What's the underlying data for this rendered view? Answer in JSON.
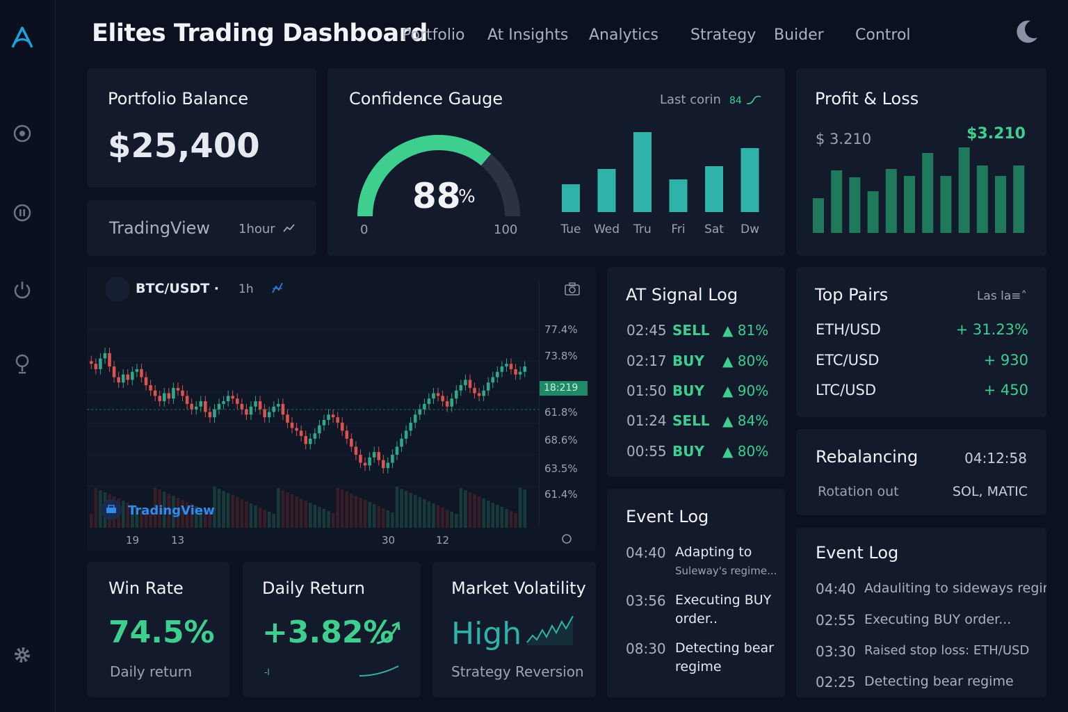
{
  "app": {
    "title": "Elites Trading Dashboard"
  },
  "nav": [
    "Portfolio",
    "At Insights",
    "Analytics",
    "Strategy",
    "Buider",
    "Control"
  ],
  "sidebar_icons": [
    "logo-icon",
    "target-icon",
    "pause-icon",
    "power-icon",
    "lightbulb-icon",
    "gear-icon"
  ],
  "portfolio": {
    "title": "Portfolio Balance",
    "value": "$25,400"
  },
  "tradingview_small": {
    "title": "TradingView",
    "interval": "1hour"
  },
  "gauge": {
    "title": "Confidence Gauge",
    "value": "88",
    "unit": "%",
    "fraction": 0.88,
    "min": "0",
    "max": "100",
    "last_label": "Last corin",
    "last_value": "84",
    "accent": "#3ecf8e"
  },
  "gauge_bars": {
    "type": "bar",
    "categories": [
      "Tue",
      "Wed",
      "Tru",
      "Fri",
      "Sat",
      "Dw"
    ],
    "values": [
      40,
      62,
      115,
      47,
      66,
      92
    ],
    "color": "#2fb3a8"
  },
  "pnl": {
    "title": "Profit & Loss",
    "left_value": "$ 3.210",
    "right_value": "$3.210",
    "chart_data": {
      "type": "bar",
      "values": [
        50,
        90,
        80,
        60,
        92,
        82,
        115,
        82,
        123,
        97,
        82,
        97
      ],
      "color": "#1e7a5a"
    }
  },
  "btc_chart": {
    "pair": "BTC/USDT",
    "interval": "1h",
    "price_labels": [
      "77.4%",
      "73.8%",
      "61.8%",
      "68.6%",
      "63.5%",
      "61.4%"
    ],
    "current_tag": "18:219",
    "x_labels": [
      "19",
      "13",
      "30",
      "12"
    ],
    "watermark": "TradingView",
    "chart_data": {
      "type": "candlestick",
      "closes": [
        72,
        70,
        74,
        76,
        71,
        67,
        65,
        68,
        66,
        69,
        70,
        67,
        64,
        62,
        60,
        58,
        61,
        59,
        63,
        62,
        60,
        57,
        55,
        56,
        58,
        54,
        52,
        55,
        57,
        58,
        60,
        59,
        57,
        55,
        53,
        56,
        58,
        55,
        52,
        54,
        56,
        57,
        53,
        50,
        48,
        47,
        45,
        42,
        44,
        46,
        49,
        51,
        53,
        52,
        50,
        47,
        44,
        41,
        38,
        35,
        34,
        37,
        39,
        36,
        33,
        35,
        38,
        41,
        44,
        47,
        50,
        53,
        55,
        57,
        59,
        61,
        60,
        58,
        56,
        59,
        62,
        64,
        66,
        63,
        61,
        60,
        62,
        65,
        67,
        69,
        71,
        72,
        70,
        68,
        69,
        71
      ]
    }
  },
  "signal_log": {
    "title": "AT Signal Log",
    "rows": [
      {
        "time": "02:45",
        "type": "SELL",
        "conf": "▲ 81%"
      },
      {
        "time": "02:17",
        "type": "BUY",
        "conf": "▲ 80%"
      },
      {
        "time": "01:50",
        "type": "BUY",
        "conf": "▲ 90%"
      },
      {
        "time": "01:24",
        "type": "SELL",
        "conf": "▲ 84%"
      },
      {
        "time": "00:55",
        "type": "BUY",
        "conf": "▲ 80%"
      }
    ]
  },
  "top_pairs": {
    "title": "Top Pairs",
    "header_right": "Las la≡˄",
    "rows": [
      {
        "pair": "ETH/USD",
        "value": "+ 31.23%"
      },
      {
        "pair": "ETC/USD",
        "value": "+ 930"
      },
      {
        "pair": "LTC/USD",
        "value": "+ 450"
      }
    ]
  },
  "rebalancing": {
    "title": "Rebalancing",
    "time": "04:12:58",
    "label": "Rotation out",
    "value": "SOL, MATIC"
  },
  "event_log_mid": {
    "title": "Event Log",
    "rows": [
      {
        "time": "04:40",
        "text": "Adapting to",
        "sub": "Suleway's regime..."
      },
      {
        "time": "03:56",
        "text": "Executing BUY",
        "sub": "order.."
      },
      {
        "time": "08:30",
        "text": "Detecting bear",
        "sub": "regime"
      }
    ]
  },
  "event_log_right": {
    "title": "Event Log",
    "rows": [
      {
        "time": "04:40",
        "text": "Adauliting to sideways regime"
      },
      {
        "time": "02:55",
        "text": "Executing BUY order..."
      },
      {
        "time": "03:30",
        "text": "Raised stop loss: ETH/USD"
      },
      {
        "time": "02:25",
        "text": "Detecting bear regime"
      }
    ]
  },
  "win_rate": {
    "title": "Win Rate",
    "value": "74.5%",
    "sub": "Daily return"
  },
  "daily_return": {
    "title": "Daily Return",
    "value": "+3.82%",
    "mini": "-l"
  },
  "volatility": {
    "title": "Market Volatility",
    "value": "High",
    "sub": "Strategy Reversion"
  },
  "colors": {
    "green": "#3ecf8e",
    "red": "#e5534b",
    "teal": "#2fb3a8",
    "card": "#121a2b",
    "bg": "#0b1120"
  }
}
